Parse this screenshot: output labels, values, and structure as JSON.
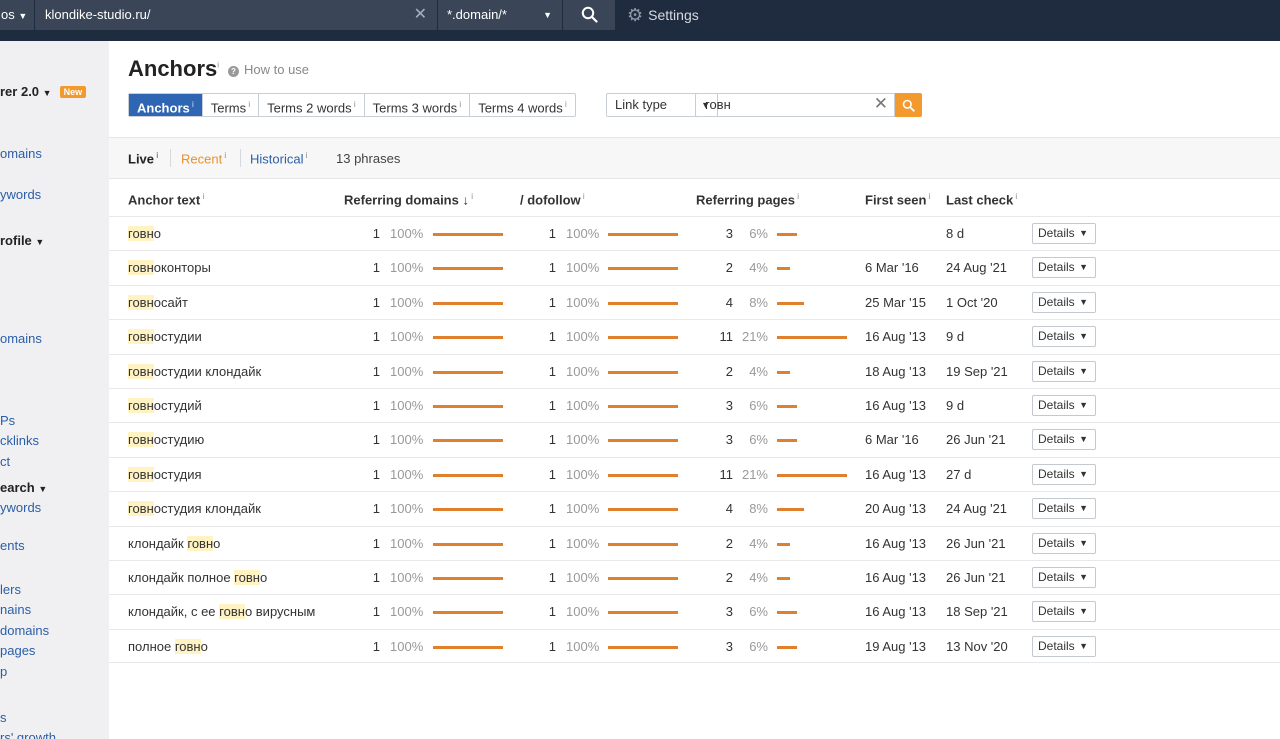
{
  "topbar": {
    "mode": "os",
    "url": "klondike-studio.ru/",
    "scope": "*.domain/*",
    "settings_label": "Settings"
  },
  "sidebar": {
    "items": [
      {
        "label": "rer 2.0",
        "badge": "New"
      },
      {
        "label": "omains"
      },
      {
        "label": "ywords"
      },
      {
        "label": "rofile"
      },
      {
        "label": "omains"
      },
      {
        "label": "Ps"
      },
      {
        "label": "cklinks"
      },
      {
        "label": "ct"
      },
      {
        "label": "earch"
      },
      {
        "label": "ywords"
      },
      {
        "label": "ents"
      },
      {
        "label": "lers"
      },
      {
        "label": "nains"
      },
      {
        "label": " domains"
      },
      {
        "label": " pages"
      },
      {
        "label": "p"
      },
      {
        "label": "s"
      },
      {
        "label": "rs' growth"
      }
    ]
  },
  "page": {
    "title": "Anchors",
    "info": "i",
    "how_to_use": "How to use"
  },
  "tabs": [
    {
      "label": "Anchors",
      "active": true
    },
    {
      "label": "Terms"
    },
    {
      "label": "Terms 2 words"
    },
    {
      "label": "Terms 3 words"
    },
    {
      "label": "Terms 4 words"
    }
  ],
  "link_type": "Link type",
  "filter": {
    "value": "говн"
  },
  "subbar": {
    "live": "Live",
    "recent": "Recent",
    "historical": "Historical",
    "count": "13 phrases"
  },
  "table": {
    "headers": {
      "anchor": "Anchor text",
      "ref_domains": "Referring domains ↓",
      "dofollow": "/ dofollow",
      "ref_pages": "Referring pages",
      "first_seen": "First seen",
      "last_check": "Last check"
    },
    "details_label": "Details",
    "rows": [
      {
        "pre": "",
        "hl": "говн",
        "post": "о",
        "rd": "1",
        "rd_pct": "100%",
        "rd_frac": 1.0,
        "df": "1",
        "df_pct": "100%",
        "df_frac": 1.0,
        "rp": "3",
        "rp_pct": "6%",
        "rp_frac": 0.06,
        "first": "",
        "last": "8 d"
      },
      {
        "pre": "",
        "hl": "говн",
        "post": "оконторы",
        "rd": "1",
        "rd_pct": "100%",
        "rd_frac": 1.0,
        "df": "1",
        "df_pct": "100%",
        "df_frac": 1.0,
        "rp": "2",
        "rp_pct": "4%",
        "rp_frac": 0.04,
        "first": "6 Mar '16",
        "last": "24 Aug '21"
      },
      {
        "pre": "",
        "hl": "говн",
        "post": "осайт",
        "rd": "1",
        "rd_pct": "100%",
        "rd_frac": 1.0,
        "df": "1",
        "df_pct": "100%",
        "df_frac": 1.0,
        "rp": "4",
        "rp_pct": "8%",
        "rp_frac": 0.08,
        "first": "25 Mar '15",
        "last": "1 Oct '20"
      },
      {
        "pre": "",
        "hl": "говн",
        "post": "остудии",
        "rd": "1",
        "rd_pct": "100%",
        "rd_frac": 1.0,
        "df": "1",
        "df_pct": "100%",
        "df_frac": 1.0,
        "rp": "11",
        "rp_pct": "21%",
        "rp_frac": 0.21,
        "first": "16 Aug '13",
        "last": "9 d"
      },
      {
        "pre": "",
        "hl": "говн",
        "post": "остудии клондайк",
        "rd": "1",
        "rd_pct": "100%",
        "rd_frac": 1.0,
        "df": "1",
        "df_pct": "100%",
        "df_frac": 1.0,
        "rp": "2",
        "rp_pct": "4%",
        "rp_frac": 0.04,
        "first": "18 Aug '13",
        "last": "19 Sep '21"
      },
      {
        "pre": "",
        "hl": "говн",
        "post": "остудий",
        "rd": "1",
        "rd_pct": "100%",
        "rd_frac": 1.0,
        "df": "1",
        "df_pct": "100%",
        "df_frac": 1.0,
        "rp": "3",
        "rp_pct": "6%",
        "rp_frac": 0.06,
        "first": "16 Aug '13",
        "last": "9 d"
      },
      {
        "pre": "",
        "hl": "говн",
        "post": "остудию",
        "rd": "1",
        "rd_pct": "100%",
        "rd_frac": 1.0,
        "df": "1",
        "df_pct": "100%",
        "df_frac": 1.0,
        "rp": "3",
        "rp_pct": "6%",
        "rp_frac": 0.06,
        "first": "6 Mar '16",
        "last": "26 Jun '21"
      },
      {
        "pre": "",
        "hl": "говн",
        "post": "остудия",
        "rd": "1",
        "rd_pct": "100%",
        "rd_frac": 1.0,
        "df": "1",
        "df_pct": "100%",
        "df_frac": 1.0,
        "rp": "11",
        "rp_pct": "21%",
        "rp_frac": 0.21,
        "first": "16 Aug '13",
        "last": "27 d"
      },
      {
        "pre": "",
        "hl": "говн",
        "post": "остудия клондайк",
        "rd": "1",
        "rd_pct": "100%",
        "rd_frac": 1.0,
        "df": "1",
        "df_pct": "100%",
        "df_frac": 1.0,
        "rp": "4",
        "rp_pct": "8%",
        "rp_frac": 0.08,
        "first": "20 Aug '13",
        "last": "24 Aug '21"
      },
      {
        "pre": "клондайк ",
        "hl": "говн",
        "post": "о",
        "rd": "1",
        "rd_pct": "100%",
        "rd_frac": 1.0,
        "df": "1",
        "df_pct": "100%",
        "df_frac": 1.0,
        "rp": "2",
        "rp_pct": "4%",
        "rp_frac": 0.04,
        "first": "16 Aug '13",
        "last": "26 Jun '21"
      },
      {
        "pre": "клондайк полное ",
        "hl": "говн",
        "post": "о",
        "rd": "1",
        "rd_pct": "100%",
        "rd_frac": 1.0,
        "df": "1",
        "df_pct": "100%",
        "df_frac": 1.0,
        "rp": "2",
        "rp_pct": "4%",
        "rp_frac": 0.04,
        "first": "16 Aug '13",
        "last": "26 Jun '21"
      },
      {
        "pre": "клондайк, с ее ",
        "hl": "говн",
        "post": "о вирусным",
        "rd": "1",
        "rd_pct": "100%",
        "rd_frac": 1.0,
        "df": "1",
        "df_pct": "100%",
        "df_frac": 1.0,
        "rp": "3",
        "rp_pct": "6%",
        "rp_frac": 0.06,
        "first": "16 Aug '13",
        "last": "18 Sep '21"
      },
      {
        "pre": "полное ",
        "hl": "говн",
        "post": "о",
        "rd": "1",
        "rd_pct": "100%",
        "rd_frac": 1.0,
        "df": "1",
        "df_pct": "100%",
        "df_frac": 1.0,
        "rp": "3",
        "rp_pct": "6%",
        "rp_frac": 0.06,
        "first": "19 Aug '13",
        "last": "13 Nov '20"
      }
    ]
  }
}
